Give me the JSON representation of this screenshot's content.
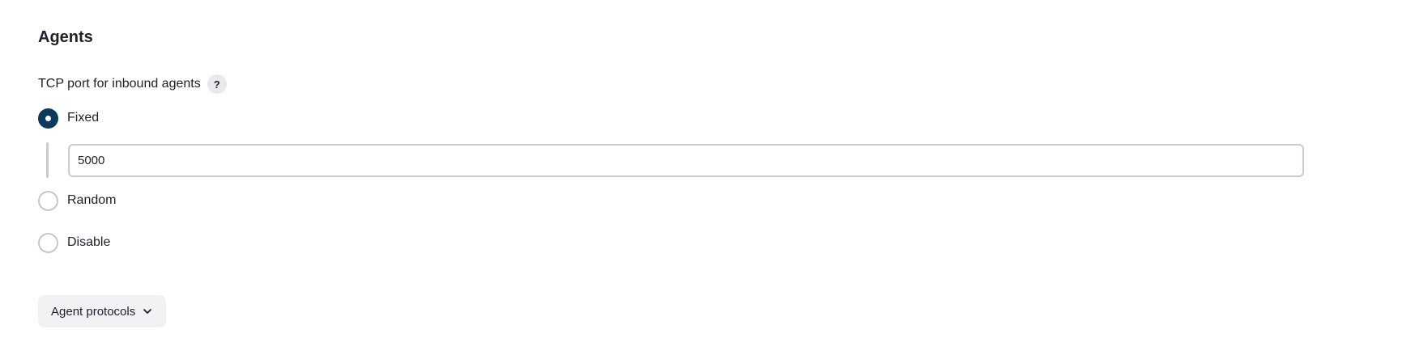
{
  "section": {
    "title": "Agents"
  },
  "tcp_port": {
    "label": "TCP port for inbound agents",
    "help_symbol": "?",
    "options": [
      {
        "label": "Fixed",
        "checked": true
      },
      {
        "label": "Random",
        "checked": false
      },
      {
        "label": "Disable",
        "checked": false
      }
    ],
    "fixed_port_value": "5000"
  },
  "protocols": {
    "button_label": "Agent protocols",
    "icon": "chevron-down-icon"
  },
  "colors": {
    "radio_checked": "#0b3a5e",
    "radio_unchecked_border": "#c5c7cc",
    "text": "#1f1f2b",
    "button_bg": "#f2f2f5"
  }
}
